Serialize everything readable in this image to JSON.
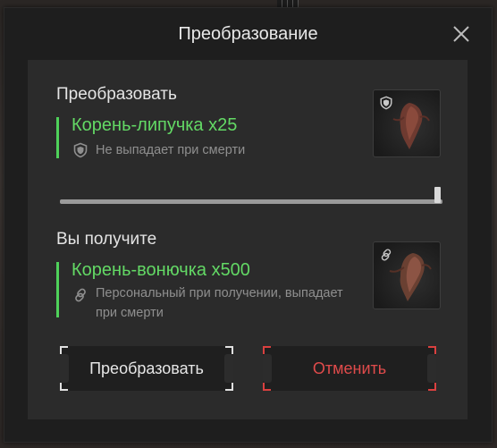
{
  "dialog": {
    "title": "Преобразование",
    "convert": {
      "label": "Преобразовать",
      "item_name": "Корень-липучка x25",
      "note": "Не выпадает при смерти",
      "note_icon": "shield-icon"
    },
    "slider": {
      "value_fraction": 1.0
    },
    "receive": {
      "label": "Вы получите",
      "item_name": "Корень-вонючка x500",
      "note_line1": "Персональный при получении, выпадает",
      "note_line2": "при смерти",
      "note_icon": "link-icon"
    },
    "buttons": {
      "confirm": "Преобразовать",
      "cancel": "Отменить"
    },
    "colors": {
      "accent_green": "#63d965",
      "cancel_red": "#e04b4b"
    }
  }
}
